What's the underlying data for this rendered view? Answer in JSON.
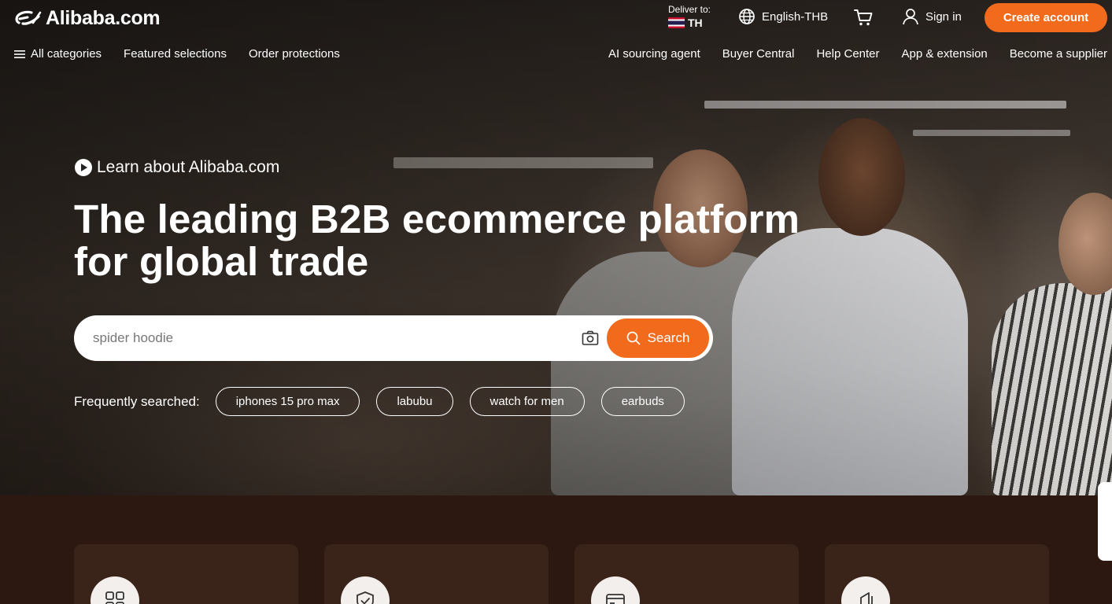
{
  "header": {
    "logo_text": "Alibaba.com",
    "deliver_label": "Deliver to:",
    "deliver_country": "TH",
    "language": "English-THB",
    "sign_in": "Sign in",
    "create_account": "Create account"
  },
  "nav": {
    "left": [
      {
        "label": "All categories",
        "icon": "menu-icon"
      },
      {
        "label": "Featured selections"
      },
      {
        "label": "Order protections"
      }
    ],
    "right": [
      {
        "label": "AI sourcing agent"
      },
      {
        "label": "Buyer Central"
      },
      {
        "label": "Help Center"
      },
      {
        "label": "App & extension"
      },
      {
        "label": "Become a supplier"
      }
    ]
  },
  "hero": {
    "learn_link": "Learn about Alibaba.com",
    "headline": "The leading B2B ecommerce platform for global trade",
    "search": {
      "placeholder": "spider hoodie",
      "value": "",
      "button_label": "Search"
    },
    "frequent_label": "Frequently searched:",
    "frequent_chips": [
      "iphones 15 pro max",
      "labubu",
      "watch for men",
      "earbuds"
    ]
  },
  "cards": [
    {
      "icon": "grid-icon"
    },
    {
      "icon": "shield-check-icon"
    },
    {
      "icon": "payment-icon"
    },
    {
      "icon": "box-icon"
    }
  ],
  "colors": {
    "accent": "#f26a1b",
    "lower_bg": "#2c1810",
    "card_bg": "#3a2419"
  }
}
